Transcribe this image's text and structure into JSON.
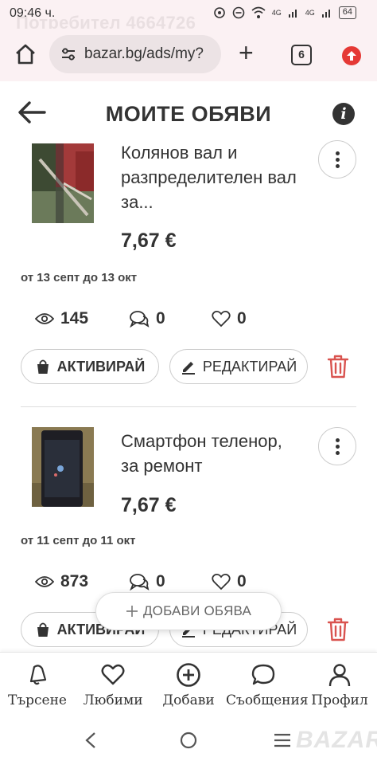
{
  "status": {
    "time": "09:46 ч.",
    "ghost_text": "Потребител 4664726",
    "battery": "64",
    "net1": "4G",
    "net2": "4G"
  },
  "browser": {
    "url": "bazar.bg/ads/my?",
    "tab_count": "6"
  },
  "header": {
    "title": "МОИТЕ ОБЯВИ"
  },
  "ads": [
    {
      "title": "Колянов вал и разпределителен вал за...",
      "price": "7,67 €",
      "period": "от 13 септ до 13 окт",
      "views": "145",
      "messages": "0",
      "likes": "0",
      "activate_label": "АКТИВИРАЙ",
      "edit_label": "РЕДАКТИРАЙ"
    },
    {
      "title": "Смартфон теленор, за ремонт",
      "price": "7,67 €",
      "period": "от 11 септ до 11 окт",
      "views": "873",
      "messages": "0",
      "likes": "0",
      "activate_label": "АКТИВИРАЙ",
      "edit_label": "РЕДАКТИРАЙ"
    }
  ],
  "fab": {
    "label": "ДОБАВИ ОБЯВА"
  },
  "nav": {
    "items": [
      {
        "label": "Търсене",
        "icon": "bell-search-icon"
      },
      {
        "label": "Любими",
        "icon": "heart-icon"
      },
      {
        "label": "Добави",
        "icon": "plus-circle-icon"
      },
      {
        "label": "Съобщения",
        "icon": "chat-icon"
      },
      {
        "label": "Профил",
        "icon": "user-icon"
      }
    ]
  },
  "watermark": "BAZAR",
  "colors": {
    "accent_red": "#d9534f",
    "text": "#333333",
    "browser_bg": "#fbf1f3"
  }
}
